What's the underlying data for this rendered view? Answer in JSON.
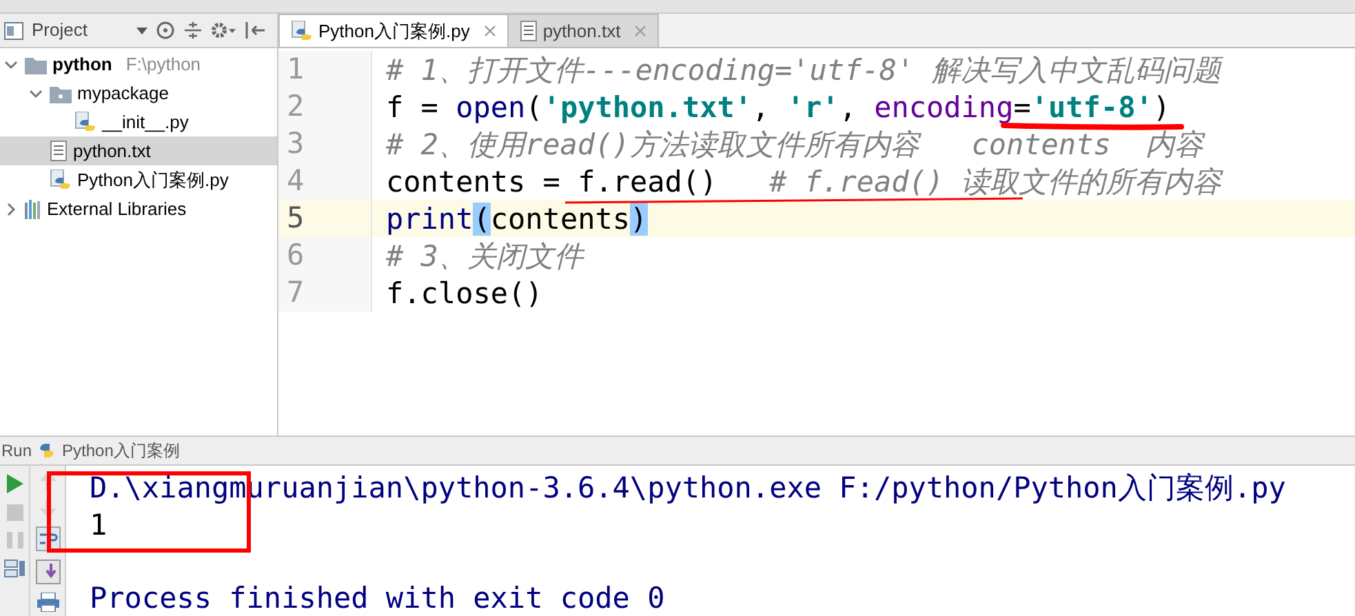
{
  "project_panel": {
    "title": "Project",
    "tree": [
      {
        "label": "python",
        "path": "F:\\python",
        "kind": "folder",
        "expanded": true,
        "selected": false,
        "children": [
          {
            "label": "mypackage",
            "kind": "package",
            "expanded": true,
            "selected": false,
            "children": [
              {
                "label": "__init__.py",
                "kind": "python",
                "selected": false
              }
            ]
          },
          {
            "label": "python.txt",
            "kind": "text",
            "selected": true
          },
          {
            "label": "Python入门案例.py",
            "kind": "python",
            "selected": false
          }
        ]
      },
      {
        "label": "External Libraries",
        "kind": "libraries",
        "expanded": false,
        "selected": false
      }
    ]
  },
  "editor": {
    "tabs": [
      {
        "label": "Python入门案例.py",
        "kind": "python",
        "selected": true
      },
      {
        "label": "python.txt",
        "kind": "text",
        "selected": false
      }
    ],
    "lines": [
      {
        "number": "1",
        "current": false,
        "tokens": [
          {
            "kind": "comment",
            "text": "# 1、打开文件---encoding='utf-8' 解决写入中文乱码问题"
          }
        ]
      },
      {
        "number": "2",
        "current": false,
        "tokens": [
          {
            "kind": "plain",
            "text": "f = "
          },
          {
            "kind": "builtin",
            "text": "open"
          },
          {
            "kind": "plain",
            "text": "("
          },
          {
            "kind": "string",
            "text": "'python.txt'"
          },
          {
            "kind": "plain",
            "text": ", "
          },
          {
            "kind": "string",
            "text": "'r'"
          },
          {
            "kind": "plain",
            "text": ", "
          },
          {
            "kind": "param",
            "text": "encoding"
          },
          {
            "kind": "plain",
            "text": "="
          },
          {
            "kind": "string",
            "text": "'utf-8'"
          },
          {
            "kind": "plain",
            "text": ")"
          }
        ]
      },
      {
        "number": "3",
        "current": false,
        "tokens": [
          {
            "kind": "comment",
            "text": "# 2、使用read()方法读取文件所有内容   contents  内容"
          }
        ]
      },
      {
        "number": "4",
        "current": false,
        "tokens": [
          {
            "kind": "plain",
            "text": "contents = f.read()   "
          },
          {
            "kind": "comment",
            "text": "# f.read() 读取文件的所有内容"
          }
        ]
      },
      {
        "number": "5",
        "current": true,
        "tokens": [
          {
            "kind": "builtin",
            "text": "print"
          },
          {
            "kind": "brace_match",
            "text": "("
          },
          {
            "kind": "plain",
            "text": "contents"
          },
          {
            "kind": "brace_match",
            "text": ")"
          }
        ]
      },
      {
        "number": "6",
        "current": false,
        "tokens": [
          {
            "kind": "comment",
            "text": "# 3、关闭文件"
          }
        ]
      },
      {
        "number": "7",
        "current": false,
        "tokens": [
          {
            "kind": "plain",
            "text": "f.close()"
          }
        ]
      }
    ]
  },
  "run_panel": {
    "label": "Run",
    "config": "Python入门案例",
    "output": [
      {
        "kind": "command",
        "text": "D.\\xiangmuruanjian\\python-3.6.4\\python.exe F:/python/Python入门案例.py"
      },
      {
        "kind": "stdout",
        "text": "1"
      },
      {
        "kind": "blank"
      },
      {
        "kind": "command",
        "text": "Process finished with exit code 0"
      }
    ]
  }
}
